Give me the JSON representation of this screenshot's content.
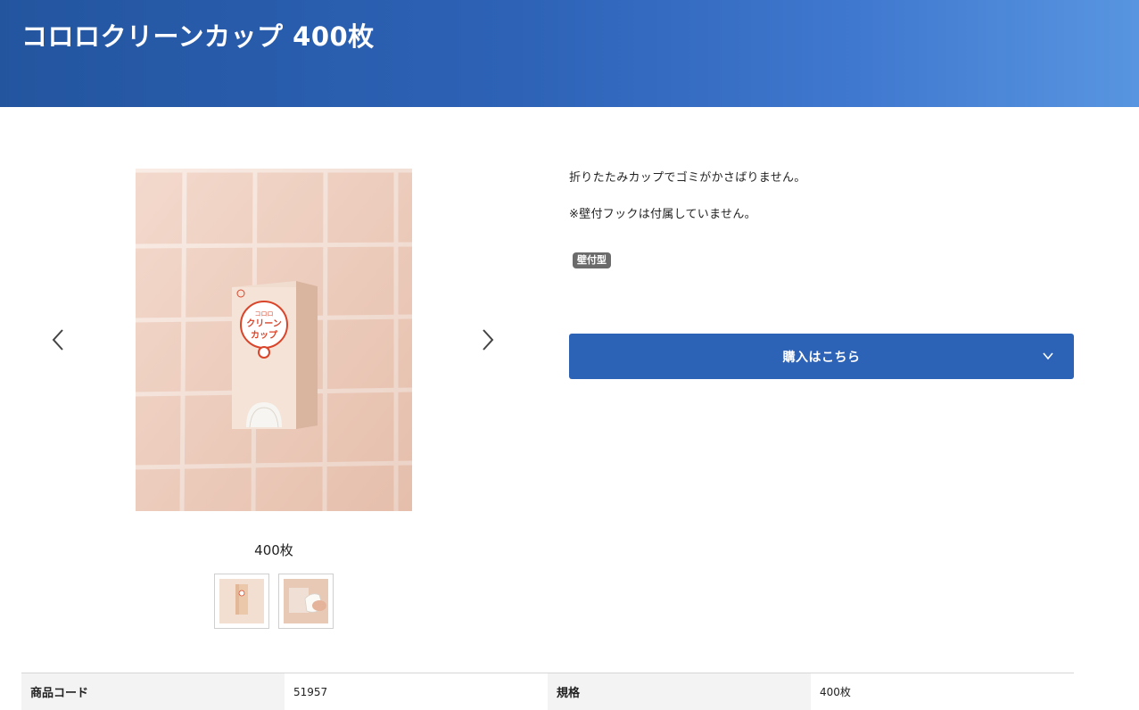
{
  "product": {
    "title": "コロロクリーンカップ 400枚",
    "description_lines": [
      "折りたたみカップでゴミがかさばりません。",
      "※壁付フックは付属していません。"
    ],
    "tag": "壁付型",
    "buy_button_label": "購入はこちら"
  },
  "gallery": {
    "current_caption": "400枚",
    "box_print": {
      "brand": "コロロ",
      "name_line1": "クリーン",
      "name_line2": "カップ"
    }
  },
  "specs": {
    "row": [
      {
        "label": "商品コード",
        "value": "51957"
      },
      {
        "label": "規格",
        "value": "400枚"
      }
    ]
  },
  "colors": {
    "header_gradient_start": "#23559f",
    "header_gradient_end": "#5895e0",
    "button": "#2d63b7",
    "tag": "#6b6b6b",
    "box_logo_red": "#d9452b"
  },
  "icons": {
    "prev": "chevron-left-icon",
    "next": "chevron-right-icon",
    "dropdown": "chevron-down-icon"
  }
}
